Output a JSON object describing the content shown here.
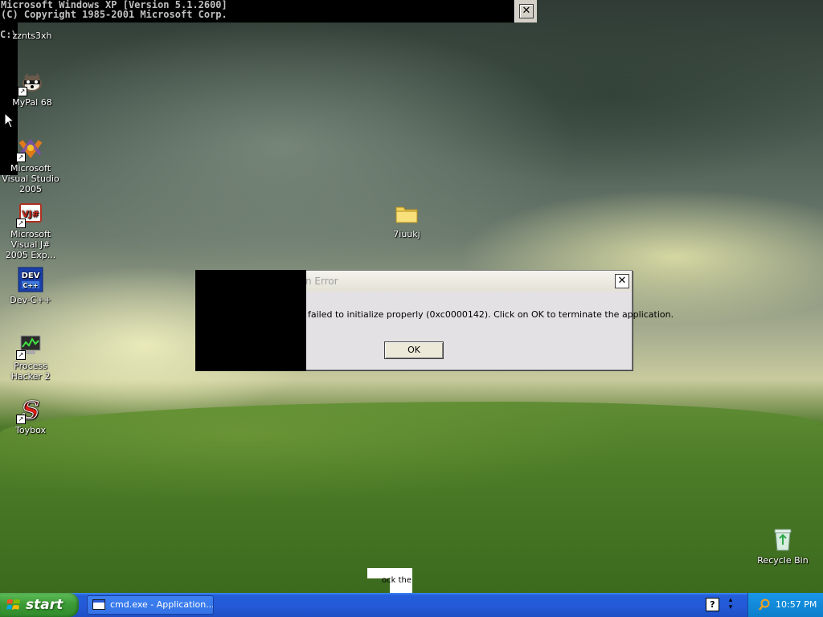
{
  "console": {
    "line1": "Microsoft Windows XP [Version 5.1.2600]",
    "line2": "(C) Copyright 1985-2001 Microsoft Corp.",
    "prompt": "C:\\",
    "close_glyph": "✕"
  },
  "desktop_icons": [
    {
      "label": "zznts3xh"
    },
    {
      "label": "MyPal 68"
    },
    {
      "label": "Microsoft Visual Studio 2005"
    },
    {
      "label": "Microsoft Visual J# 2005 Exp..."
    },
    {
      "label": "Dev-C++"
    },
    {
      "label": "Process Hacker 2"
    },
    {
      "label": "Toybox"
    },
    {
      "label": "7iuukj"
    },
    {
      "label": "Recycle Bin"
    }
  ],
  "dialog": {
    "title": "n Error",
    "message": "failed to initialize properly (0xc0000142). Click on OK to terminate the application.",
    "ok_label": "OK",
    "close_glyph": "✕"
  },
  "fragment": {
    "text": "ock the"
  },
  "taskbar": {
    "start_label": "start",
    "task_item_label": "cmd.exe - Application...",
    "help_glyph": "?",
    "clock": "10:57 PM"
  },
  "colors": {
    "taskbar_blue": "#245edb",
    "start_green": "#3d9c36",
    "tray_blue": "#128ad9",
    "dialog_bg": "#ece9d8"
  }
}
